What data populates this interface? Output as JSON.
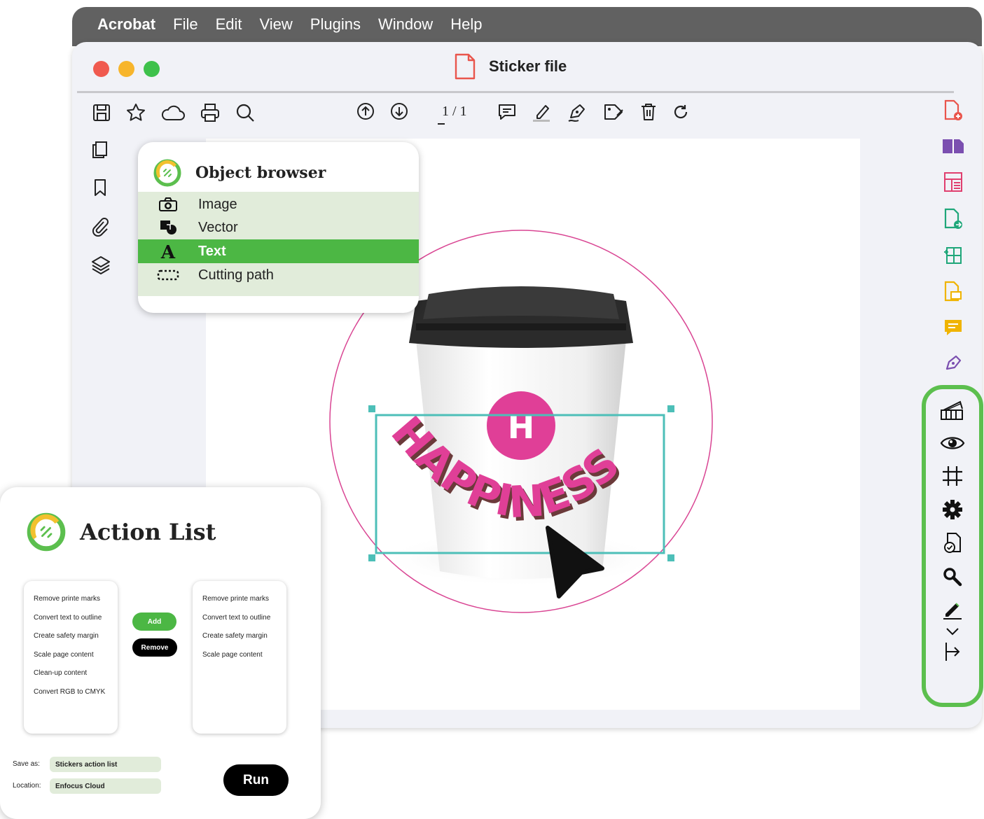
{
  "menu": {
    "app": "Acrobat",
    "items": [
      "File",
      "Edit",
      "View",
      "Plugins",
      "Window",
      "Help"
    ]
  },
  "window": {
    "title": "Sticker file",
    "page_counter": "1 / 1",
    "traffic_colors": [
      "#f05a4f",
      "#f7b52c",
      "#3ec14b"
    ]
  },
  "object_browser": {
    "title": "Object browser",
    "items": [
      {
        "label": "Image",
        "icon": "camera-icon"
      },
      {
        "label": "Vector",
        "icon": "shapes-icon"
      },
      {
        "label": "Text",
        "icon": "text-icon",
        "selected": true
      },
      {
        "label": "Cutting path",
        "icon": "cutting-path-icon"
      }
    ]
  },
  "sticker": {
    "badge_letter": "H",
    "text": "HAPPINESS",
    "accent": "#e03f97"
  },
  "action_list": {
    "title": "Action List",
    "available": [
      "Remove printe marks",
      "Convert text to outline",
      "Create safety margin",
      "Scale page content",
      "Clean-up content",
      "Convert RGB to CMYK"
    ],
    "selected": [
      "Remove printe marks",
      "Convert text to outline",
      "Create safety margin",
      "Scale page content"
    ],
    "add_label": "Add",
    "remove_label": "Remove",
    "save_as_label": "Save as:",
    "save_as_value": "Stickers action list",
    "location_label": "Location:",
    "location_value": "Enfocus Cloud",
    "run_label": "Run"
  },
  "colors": {
    "accent_green": "#5cbf4e",
    "selection_teal": "#4dbfb8",
    "text_pink": "#e03f97"
  }
}
